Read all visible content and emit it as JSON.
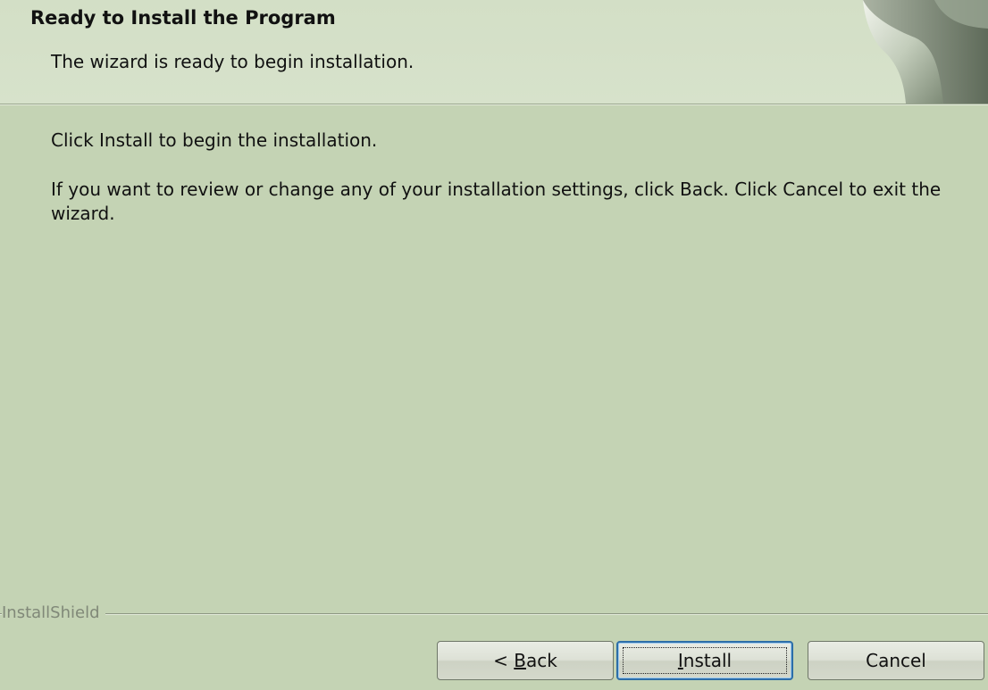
{
  "header": {
    "title": "Ready to Install the Program",
    "subtitle": "The wizard is ready to begin installation."
  },
  "body": {
    "line1": "Click Install to begin the installation.",
    "line2": "If you want to review or change any of your installation settings, click Back. Click Cancel to exit the wizard."
  },
  "footer": {
    "brand": "InstallShield"
  },
  "buttons": {
    "back_prefix": "< ",
    "back_mnemonic": "B",
    "back_rest": "ack",
    "install_mnemonic": "I",
    "install_rest": "nstall",
    "cancel": "Cancel"
  },
  "icons": {
    "header_graphic": "page-curl-graphic"
  },
  "colors": {
    "background": "#c4d3b4",
    "header_background": "#d7e2cb",
    "focus_border": "#2d6ea8"
  }
}
